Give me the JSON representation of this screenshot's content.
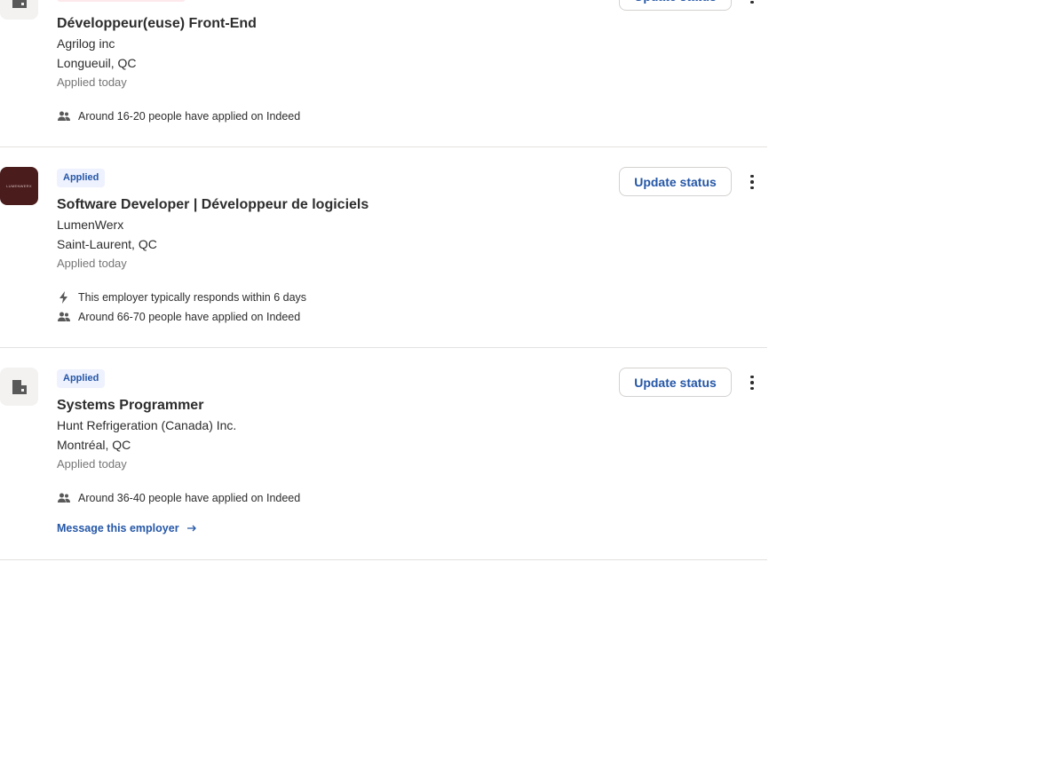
{
  "applications": [
    {
      "status": "",
      "title": "Développeur(euse) Front-End",
      "company": "Agrilog inc",
      "location": "Longueuil, QC",
      "applied": "Applied today",
      "applicants": "Around 16-20 people have applied on Indeed",
      "update_label": "Update status"
    },
    {
      "status": "Applied",
      "logo_text": "LUMENWERX",
      "title": "Software Developer | Développeur de logiciels",
      "company": "LumenWerx",
      "location": "Saint-Laurent, QC",
      "applied": "Applied today",
      "response": "This employer typically responds within 6 days",
      "applicants": "Around 66-70 people have applied on Indeed",
      "update_label": "Update status"
    },
    {
      "status": "Applied",
      "title": "Systems Programmer",
      "company": "Hunt Refrigeration (Canada) Inc.",
      "location": "Montréal, QC",
      "applied": "Applied today",
      "applicants": "Around 36-40 people have applied on Indeed",
      "message_link": "Message this employer",
      "update_label": "Update status"
    }
  ]
}
